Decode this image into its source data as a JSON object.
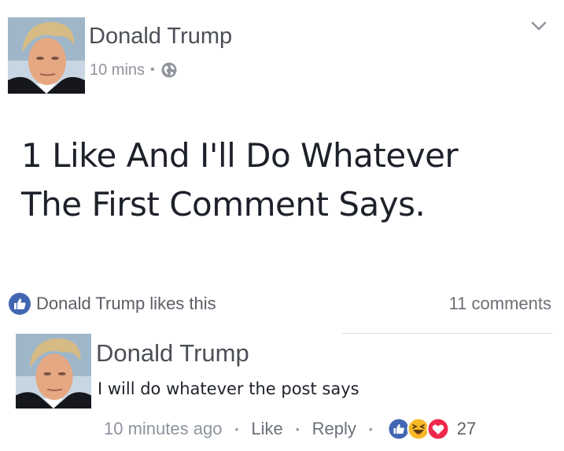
{
  "post": {
    "author": "Donald Trump",
    "time": "10 mins",
    "meta_separator": "•",
    "audience_icon": "globe-icon",
    "menu_icon": "chevron-down-icon",
    "text_line1": "1 Like And I'll Do Whatever",
    "text_line2": "The First Comment Says."
  },
  "engagement": {
    "like_icon": "like-icon",
    "likes_text": "Donald Trump likes this",
    "comments_count": "11 comments"
  },
  "comment": {
    "author": "Donald Trump",
    "text": "I will do whatever the post says",
    "time": "10 minutes ago",
    "separator": "•",
    "like_label": "Like",
    "reply_label": "Reply",
    "reaction_icons": [
      "like-icon",
      "haha-icon",
      "love-icon"
    ],
    "reaction_count": "27"
  },
  "colors": {
    "facebook_blue": "#4267b2",
    "haha_yellow": "#f7b928",
    "love_red": "#f0284a",
    "name_gray": "#4b4f56",
    "meta_gray": "#90949c"
  }
}
